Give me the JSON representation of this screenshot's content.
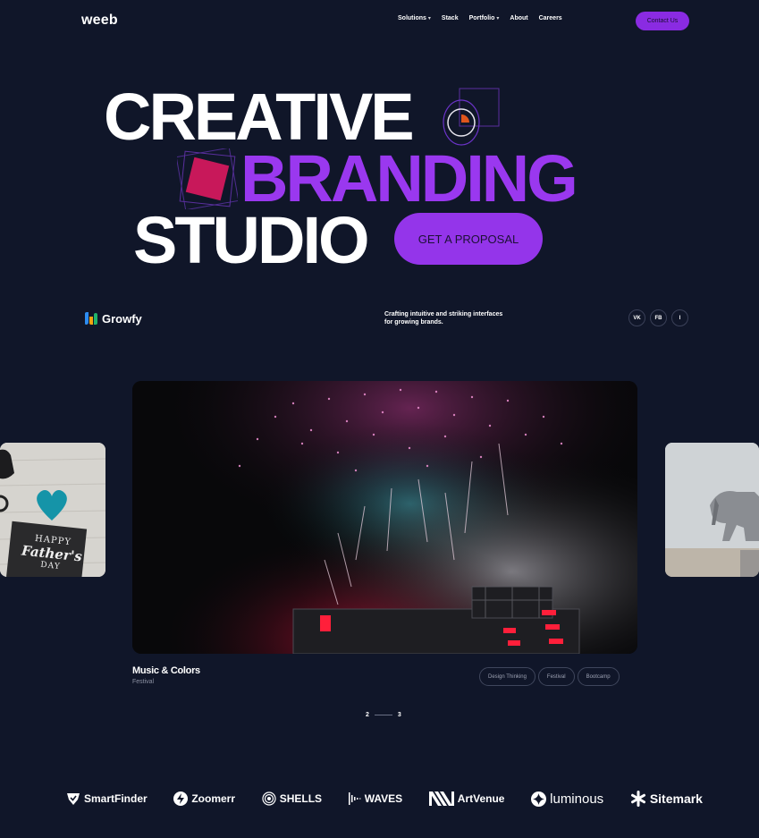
{
  "nav": {
    "logo": "weeb",
    "items": [
      {
        "label": "Solutions",
        "caret": "▾"
      },
      {
        "label": "Stack",
        "caret": ""
      },
      {
        "label": "Portfolio",
        "caret": "▾"
      },
      {
        "label": "About",
        "caret": ""
      },
      {
        "label": "Careers",
        "caret": ""
      }
    ],
    "contact_label": "Contact Us"
  },
  "hero": {
    "line1": "CREATIVE",
    "line2": "BRANDING",
    "line3": "STUDIO",
    "cta_label": "GET A PROPOSAL"
  },
  "brand_bar": {
    "brand_name": "Growfy",
    "tagline_line1": "Crafting intuitive and striking interfaces",
    "tagline_line2": "for growing brands.",
    "socials": [
      "VK",
      "FB",
      "I"
    ]
  },
  "gallery": {
    "left_card_text": {
      "line1": "HAPPY",
      "line2": "Father's",
      "line3": "DAY"
    },
    "title": "Music & Colors",
    "subtitle": "Festival",
    "tags": [
      "Design Thinking",
      "Festival",
      "Bootcamp"
    ],
    "pager": {
      "current": "2",
      "next": "3"
    }
  },
  "partners": [
    {
      "name": "SmartFinder",
      "icon": "shield-check-icon"
    },
    {
      "name": "Zoomerr",
      "icon": "bolt-circle-icon"
    },
    {
      "name": "SHELLS",
      "icon": "concentric-circles-icon"
    },
    {
      "name": "WAVES",
      "icon": "sound-wave-icon"
    },
    {
      "name": "ArtVenue",
      "icon": "stripes-icon"
    },
    {
      "name": "luminous",
      "icon": "sparkle-circle-icon"
    },
    {
      "name": "Sitemark",
      "icon": "asterisk-icon"
    }
  ],
  "colors": {
    "background": "#101629",
    "accent": "#9435ea",
    "hero_accent": "#9a38ef",
    "deco_red": "#c8185a",
    "deco_orange": "#e0561d"
  }
}
